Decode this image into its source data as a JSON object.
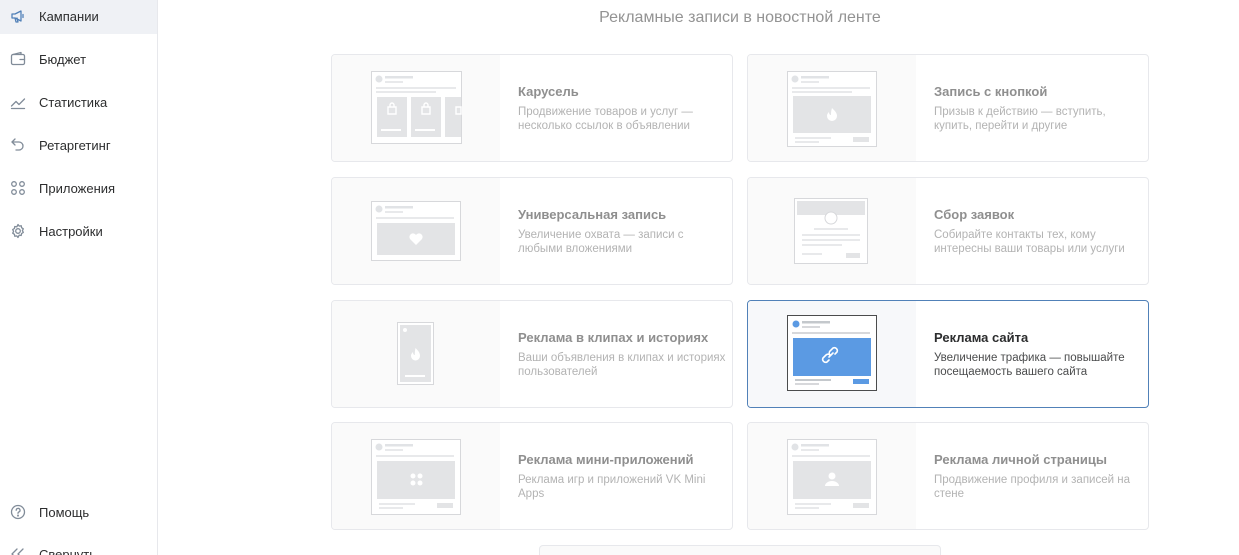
{
  "sidebar": {
    "items": [
      {
        "label": "Кампании",
        "icon": "megaphone-icon",
        "active": true
      },
      {
        "label": "Бюджет",
        "icon": "wallet-icon"
      },
      {
        "label": "Статистика",
        "icon": "chart-icon"
      },
      {
        "label": "Ретаргетинг",
        "icon": "undo-arrow-icon"
      },
      {
        "label": "Приложения",
        "icon": "apps-grid-icon"
      },
      {
        "label": "Настройки",
        "icon": "gear-icon"
      }
    ],
    "bottom": [
      {
        "label": "Помощь",
        "icon": "help-icon"
      },
      {
        "label": "Свернуть",
        "icon": "collapse-icon"
      }
    ]
  },
  "main": {
    "title": "Рекламные записи в новостной ленте",
    "cards": [
      {
        "title": "Карусель",
        "desc": "Продвижение товаров и услуг — несколько ссылок в объявлении"
      },
      {
        "title": "Запись с кнопкой",
        "desc": "Призыв к действию — вступить, купить, перейти и другие"
      },
      {
        "title": "Универсальная запись",
        "desc": "Увеличение охвата — записи с любыми вложениями"
      },
      {
        "title": "Сбор заявок",
        "desc": "Собирайте контакты тех, кому интересны ваши товары или услуги"
      },
      {
        "title": "Реклама в клипах и историях",
        "desc": "Ваши объявления в клипах и историях пользователей"
      },
      {
        "title": "Реклама сайта",
        "desc": "Увеличение трафика — повышайте посещаемость вашего сайта",
        "selected": true
      },
      {
        "title": "Реклама мини-приложений",
        "desc": "Реклама игр и приложений VK Mini Apps"
      },
      {
        "title": "Реклама личной страницы",
        "desc": "Продвижение профиля и записей на стене"
      }
    ]
  },
  "colors": {
    "accent": "#5181b8",
    "selected_thumb": "#5b9ae3",
    "border": "#e7e8ec",
    "active_nav": "#eff1f5"
  }
}
